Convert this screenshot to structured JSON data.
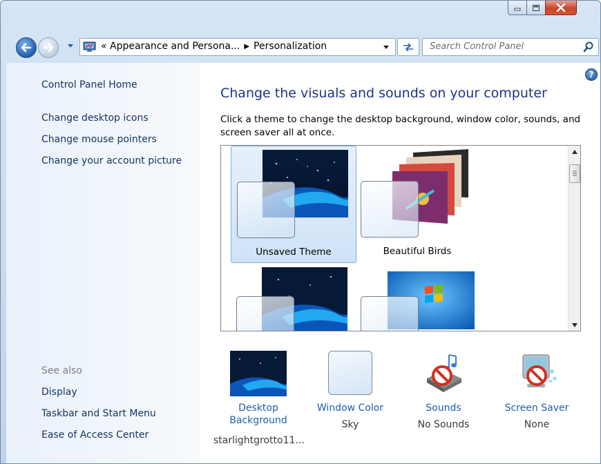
{
  "window": {
    "minimize_label": "minimize",
    "maximize_label": "maximize",
    "close_label": "close"
  },
  "navigation": {
    "address_overflow": "«",
    "breadcrumbs": [
      "Appearance and Persona...",
      "Personalization"
    ],
    "search_placeholder": "Search Control Panel"
  },
  "sidebar": {
    "home": "Control Panel Home",
    "tasks": [
      "Change desktop icons",
      "Change mouse pointers",
      "Change your account picture"
    ],
    "see_also_label": "See also",
    "see_also_links": [
      "Display",
      "Taskbar and Start Menu",
      "Ease of Access Center"
    ]
  },
  "main": {
    "heading": "Change the visuals and sounds on your computer",
    "description": "Click a theme to change the desktop background, window color, sounds, and screen saver all at once.",
    "themes": [
      {
        "label": "Unsaved Theme",
        "selected": true
      },
      {
        "label": "Beautiful Birds",
        "selected": false
      },
      {
        "label": "",
        "selected": false
      },
      {
        "label": "",
        "selected": false
      }
    ],
    "settings": [
      {
        "label": "Desktop Background",
        "value": "starlightgrotto11..."
      },
      {
        "label": "Window Color",
        "value": "Sky"
      },
      {
        "label": "Sounds",
        "value": "No Sounds"
      },
      {
        "label": "Screen Saver",
        "value": "None"
      }
    ]
  },
  "colors": {
    "link": "#1c5fae",
    "heading": "#1e3287",
    "sidebar_link": "#16325c",
    "selection": "#cfe2f7"
  },
  "icons": [
    "back-icon",
    "forward-icon",
    "control-panel-icon",
    "refresh-icon",
    "search-icon",
    "help-icon",
    "no-sound-icon",
    "no-screensaver-icon"
  ]
}
